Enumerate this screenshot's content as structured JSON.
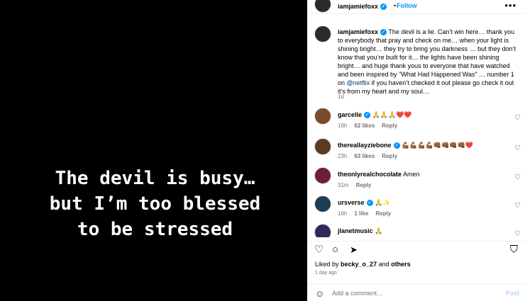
{
  "media": {
    "text": "The devil is busy…\nbut I’m too blessed\nto be stressed"
  },
  "header": {
    "username": "iamjamiefoxx",
    "verified": "✓",
    "separator": "•",
    "follow_label": "Follow",
    "more_icon": "•••"
  },
  "caption": {
    "username": "iamjamiefoxx",
    "verified": "✓",
    "text_before": "The devil is a lie. Can’t win here… thank you to everybody that pray and check on me… when your light is shining bright… they try to bring you darkness … but they don’t know that you’re built for it… the lights have been shining bright… and huge thank yous to everyone that have watched and been inspired by \"What Had Happened Was\" … number 1 on ",
    "mention": "@netflix",
    "text_after": " if you haven’t checked it out please go check it out it’s from my heart and my soul…",
    "time": "1d"
  },
  "comments": [
    {
      "username": "garcelle",
      "verified": "✓",
      "text": "🙏🙏🙏❤️❤️",
      "time": "16h",
      "likes": "62 likes",
      "reply": "Reply"
    },
    {
      "username": "thereallayziebone",
      "verified": "✓",
      "text": "💪🏾💪🏾💪🏾💪🏾👊🏾👊🏾👊🏾👊🏾❤️",
      "time": "23h",
      "likes": "63 likes",
      "reply": "Reply"
    },
    {
      "username": "theonlyrealchocolate",
      "verified": "",
      "text": "Amen",
      "time": "31m",
      "likes": "",
      "reply": "Reply"
    },
    {
      "username": "ursverse",
      "verified": "✓",
      "text": "🙏✨",
      "time": "16h",
      "likes": "1 like",
      "reply": "Reply"
    },
    {
      "username": "jlanetmusic",
      "verified": "",
      "text": "🙏",
      "time": "",
      "likes": "",
      "reply": ""
    }
  ],
  "icons": {
    "heart": "♡",
    "comment": "○",
    "share": "➤",
    "bookmark": "⛉",
    "emoji": "☺"
  },
  "likes_line": {
    "prefix": "Liked by ",
    "user": "becky_o_27",
    "middle": " and ",
    "others": "others"
  },
  "posted": "1 day ago",
  "add_comment": {
    "placeholder": "Add a comment…",
    "post_label": "Post"
  }
}
